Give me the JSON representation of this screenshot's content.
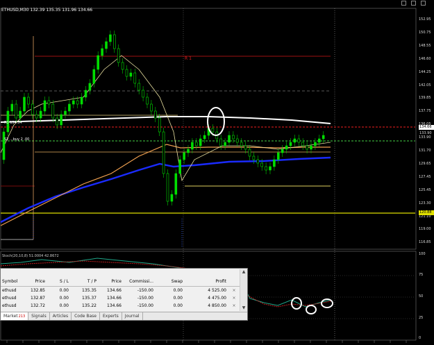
{
  "window": {
    "title": "ETHUSD,M30"
  },
  "chart": {
    "header_text": "ETHUSD,M30  132.39 135.35 131.96 134.66",
    "r1_label": "R 1",
    "line_label_1": "R3 134.54",
    "line_label_2": "S2 ...buy 2 .00",
    "price_labels": [
      "152.95",
      "150.75",
      "148.55",
      "146.60",
      "144.25",
      "142.05",
      "139.85",
      "137.75",
      "136.05",
      "133.90",
      "131.70",
      "129.65",
      "127.45",
      "125.45",
      "123.30",
      "121.10",
      "119.00",
      "116.85"
    ],
    "current_price_tag": "134.66",
    "line_price_tag": "133.90",
    "support_price_tag": "120.88",
    "colors": {
      "bull": "#00cc00",
      "bear": "#00cc00",
      "ma_blue": "#1a2bff",
      "ma_orange": "#f0a050",
      "ma_white": "#ffffff",
      "support": "#e0e000",
      "resistance": "#c01818"
    }
  },
  "stochastic": {
    "title": "Stoch(20,10,8) 51.0004 42.8672",
    "levels": [
      "100",
      "75",
      "50",
      "25",
      "0"
    ]
  },
  "terminal": {
    "columns": [
      "Symbol",
      "Price",
      "S / L",
      "T / P",
      "Price",
      "Commissi...",
      "Swap",
      "Profit"
    ],
    "rows": [
      {
        "symbol": "ethusd",
        "price": "132.85",
        "sl": "0.00",
        "tp": "135.35",
        "current": "134.66",
        "commission": "-150.00",
        "swap": "0.00",
        "profit": "4 525.00"
      },
      {
        "symbol": "ethusd",
        "price": "132.87",
        "sl": "0.00",
        "tp": "135.37",
        "current": "134.66",
        "commission": "-150.00",
        "swap": "0.00",
        "profit": "4 475.00"
      },
      {
        "symbol": "ethusd",
        "price": "132.72",
        "sl": "0.00",
        "tp": "135.22",
        "current": "134.66",
        "commission": "-150.00",
        "swap": "0.00",
        "profit": "4 850.00"
      }
    ],
    "tabs": [
      {
        "label": "Market",
        "badge": "213"
      },
      {
        "label": "Signals",
        "badge": ""
      },
      {
        "label": "Articles",
        "badge": ""
      },
      {
        "label": "Code Base",
        "badge": ""
      },
      {
        "label": "Experts",
        "badge": ""
      },
      {
        "label": "Journal",
        "badge": ""
      }
    ]
  }
}
